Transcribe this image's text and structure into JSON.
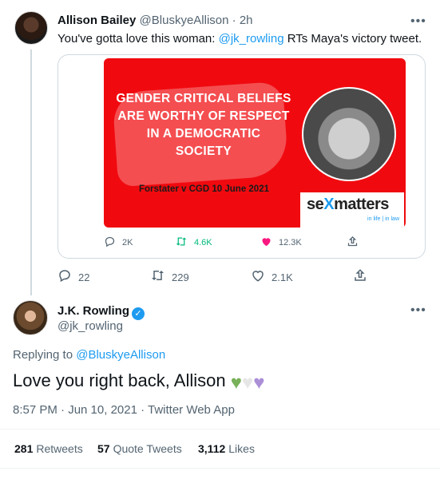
{
  "reply_tweet": {
    "display_name": "Allison Bailey",
    "handle": "@BluskyeAllison",
    "separator": "·",
    "time": "2h",
    "more": "•••",
    "text_before": "You've gotta love this woman: ",
    "mention": "@jk_rowling",
    "text_after": " RTs Maya's victory tweet.",
    "actions": {
      "reply_count": "22",
      "retweet_count": "229",
      "like_count": "2.1K"
    }
  },
  "embed": {
    "banner_lines": [
      "GENDER CRITICAL BELIEFS",
      "ARE WORTHY OF RESPECT",
      "IN A DEMOCRATIC",
      "SOCIETY"
    ],
    "caption": "Forstater v CGD 10 June 2021",
    "logo_pre": "se",
    "logo_x": "X",
    "logo_post": "matters",
    "logo_tag": "in life | in law",
    "actions": {
      "reply_count": "2K",
      "retweet_count": "4.6K",
      "like_count": "12.3K"
    }
  },
  "main_tweet": {
    "display_name": "J.K. Rowling",
    "handle": "@jk_rowling",
    "more": "•••",
    "replying_prefix": "Replying to ",
    "replying_handle": "@BluskyeAllison",
    "text": "Love you right back, Allison",
    "timestamp": "8:57 PM · Jun 10, 2021 · Twitter Web App",
    "stats": {
      "retweets_count": "281",
      "retweets_label": "Retweets",
      "quotes_count": "57",
      "quotes_label": "Quote Tweets",
      "likes_count": "3,112",
      "likes_label": "Likes"
    }
  },
  "colors": {
    "accent": "#1d9bf0",
    "banner_red": "#f00a0f",
    "retweet_green": "#00ba7c",
    "like_red": "#f91880",
    "heart_green": "#78b159",
    "heart_white": "#e6e6e6",
    "heart_purple": "#aa8ed6"
  },
  "icons": [
    "reply-icon",
    "retweet-icon",
    "like-icon",
    "share-icon",
    "verified-icon",
    "more-icon"
  ]
}
